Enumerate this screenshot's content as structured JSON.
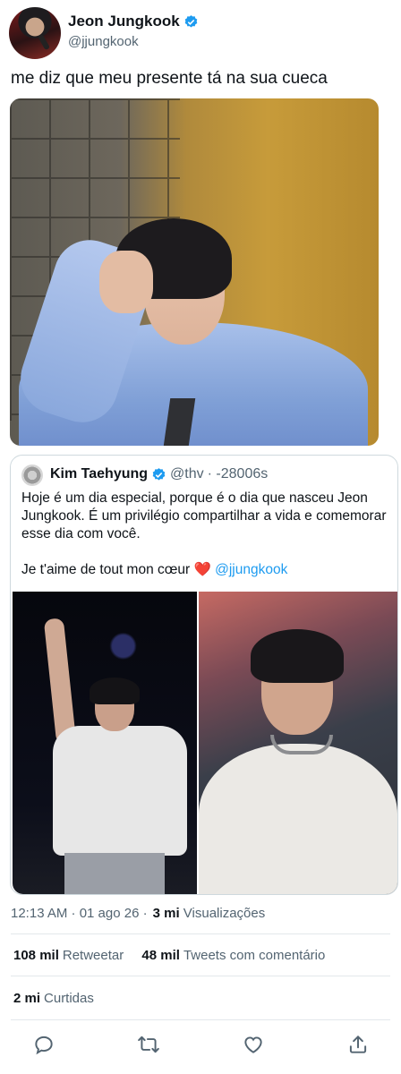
{
  "user": {
    "display_name": "Jeon Jungkook",
    "handle": "@jjungkook"
  },
  "tweet": {
    "text": "me diz que meu presente tá na sua cueca"
  },
  "quote": {
    "display_name": "Kim Taehyung",
    "handle": "@thv",
    "time": "· -28006s",
    "paragraph1": "Hoje é um dia especial, porque é o dia que nasceu Jeon Jungkook. É um privilégio compartilhar a vida e comemorar esse dia com você.",
    "paragraph2_text": "Je t'aime de tout mon cœur ❤️ ",
    "paragraph2_mention": "@jjungkook"
  },
  "meta": {
    "timestamp": "12:13 AM · 01 ago 26 ·",
    "views_count": "3 mi",
    "views_label": "Visualizações"
  },
  "stats": {
    "retweets_count": "108 mil",
    "retweets_label": "Retweetar",
    "quotes_count": "48 mil",
    "quotes_label": "Tweets com comentário",
    "likes_count": "2 mi",
    "likes_label": "Curtidas"
  },
  "icons": {
    "reply": "reply-icon",
    "retweet": "retweet-icon",
    "like": "heart-icon",
    "share": "share-icon",
    "verified": "verified-badge-icon"
  },
  "colors": {
    "verified": "#1d9bf0",
    "mention": "#1d9bf0",
    "secondary_text": "#536471"
  }
}
